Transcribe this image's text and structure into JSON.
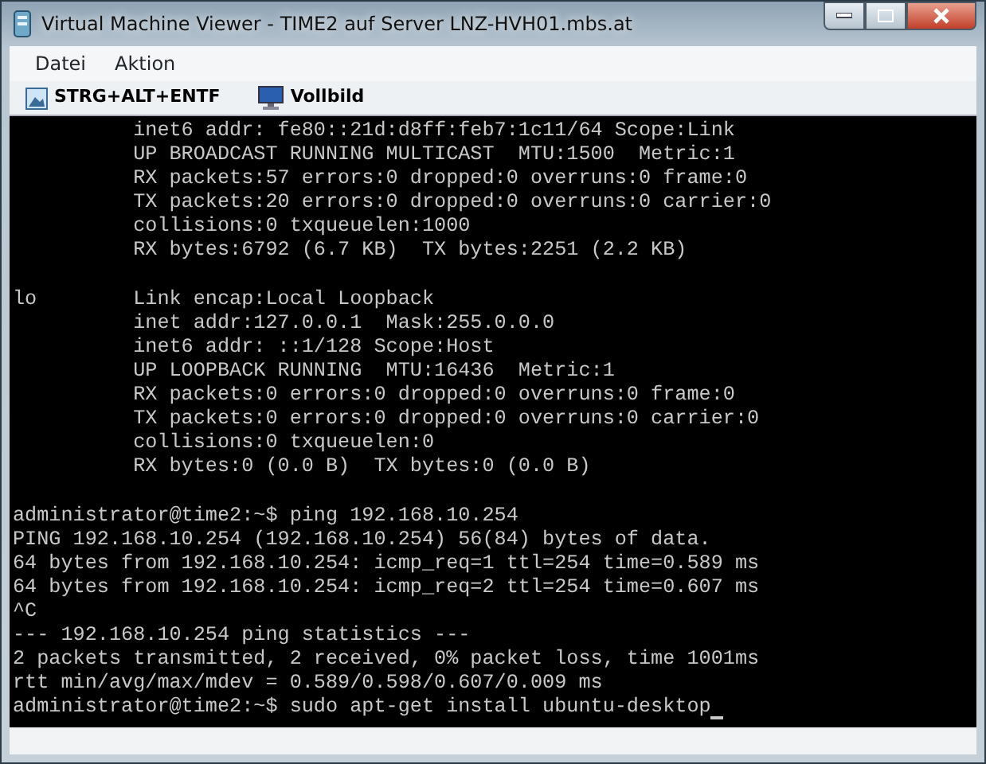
{
  "window": {
    "title": "Virtual Machine Viewer - TIME2 auf Server LNZ-HVH01.mbs.at"
  },
  "menu": [
    "Datei",
    "Aktion"
  ],
  "toolbar": [
    {
      "label": "STRG+ALT+ENTF",
      "kind": "ctrl-alt-del"
    },
    {
      "label": "Vollbild",
      "kind": "fullscreen"
    }
  ],
  "terminal": {
    "cursor_visible": true,
    "lines": [
      {
        "kind": "text",
        "text": "          inet6 addr: fe80::21d:d8ff:feb7:1c11/64 Scope:Link"
      },
      {
        "kind": "text",
        "text": "          UP BROADCAST RUNNING MULTICAST  MTU:1500  Metric:1"
      },
      {
        "kind": "text",
        "text": "          RX packets:57 errors:0 dropped:0 overruns:0 frame:0"
      },
      {
        "kind": "text",
        "text": "          TX packets:20 errors:0 dropped:0 overruns:0 carrier:0"
      },
      {
        "kind": "text",
        "text": "          collisions:0 txqueuelen:1000"
      },
      {
        "kind": "text",
        "text": "          RX bytes:6792 (6.7 KB)  TX bytes:2251 (2.2 KB)"
      },
      {
        "kind": "blank"
      },
      {
        "kind": "text",
        "text": "lo        Link encap:Local Loopback"
      },
      {
        "kind": "text",
        "text": "          inet addr:127.0.0.1  Mask:255.0.0.0"
      },
      {
        "kind": "text",
        "text": "          inet6 addr: ::1/128 Scope:Host"
      },
      {
        "kind": "text",
        "text": "          UP LOOPBACK RUNNING  MTU:16436  Metric:1"
      },
      {
        "kind": "text",
        "text": "          RX packets:0 errors:0 dropped:0 overruns:0 frame:0"
      },
      {
        "kind": "text",
        "text": "          TX packets:0 errors:0 dropped:0 overruns:0 carrier:0"
      },
      {
        "kind": "text",
        "text": "          collisions:0 txqueuelen:0"
      },
      {
        "kind": "text",
        "text": "          RX bytes:0 (0.0 B)  TX bytes:0 (0.0 B)"
      },
      {
        "kind": "blank"
      },
      {
        "kind": "text",
        "text": "administrator@time2:~$ ping 192.168.10.254"
      },
      {
        "kind": "text",
        "text": "PING 192.168.10.254 (192.168.10.254) 56(84) bytes of data."
      },
      {
        "kind": "text",
        "text": "64 bytes from 192.168.10.254: icmp_req=1 ttl=254 time=0.589 ms"
      },
      {
        "kind": "text",
        "text": "64 bytes from 192.168.10.254: icmp_req=2 ttl=254 time=0.607 ms"
      },
      {
        "kind": "text",
        "text": "^C"
      },
      {
        "kind": "text",
        "text": "--- 192.168.10.254 ping statistics ---"
      },
      {
        "kind": "text",
        "text": "2 packets transmitted, 2 received, 0% packet loss, time 1001ms"
      },
      {
        "kind": "text",
        "text": "rtt min/avg/max/mdev = 0.589/0.598/0.607/0.009 ms"
      },
      {
        "kind": "prompt",
        "text": "administrator@time2:~$ sudo apt-get install ubuntu-desktop"
      }
    ]
  }
}
